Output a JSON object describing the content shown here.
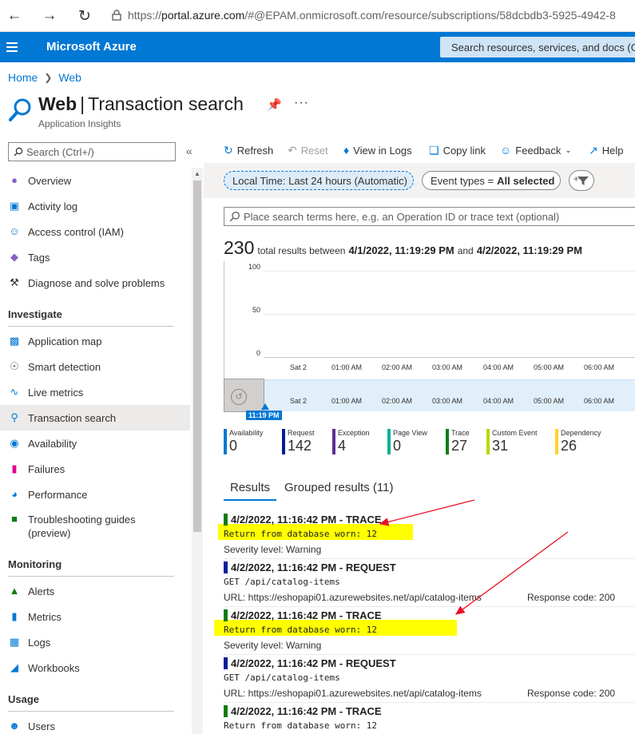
{
  "browser": {
    "url_prefix": "https://",
    "url_host": "portal.azure.com",
    "url_rest": "/#@EPAM.onmicrosoft.com/resource/subscriptions/58dcbdb3-5925-4942-8"
  },
  "header": {
    "brand": "Microsoft Azure",
    "search_placeholder": "Search resources, services, and docs (G+/)"
  },
  "breadcrumb": {
    "home": "Home",
    "current": "Web"
  },
  "title": {
    "resource": "Web",
    "separator": "|",
    "page": "Transaction search",
    "subtitle": "Application Insights"
  },
  "sidebar": {
    "search_placeholder": "Search (Ctrl+/)",
    "items_top": [
      {
        "label": "Overview",
        "icon": "bulb-icon"
      },
      {
        "label": "Activity log",
        "icon": "activity-log-icon"
      },
      {
        "label": "Access control (IAM)",
        "icon": "people-icon"
      },
      {
        "label": "Tags",
        "icon": "tag-icon"
      },
      {
        "label": "Diagnose and solve problems",
        "icon": "wrench-icon"
      }
    ],
    "sections": {
      "investigate": "Investigate",
      "monitoring": "Monitoring",
      "usage": "Usage"
    },
    "investigate_items": [
      {
        "label": "Application map",
        "icon": "app-map-icon"
      },
      {
        "label": "Smart detection",
        "icon": "smart-detection-icon"
      },
      {
        "label": "Live metrics",
        "icon": "live-metrics-icon"
      },
      {
        "label": "Transaction search",
        "icon": "search-icon"
      },
      {
        "label": "Availability",
        "icon": "globe-icon"
      },
      {
        "label": "Failures",
        "icon": "failures-icon"
      },
      {
        "label": "Performance",
        "icon": "performance-icon"
      },
      {
        "label": "Troubleshooting guides",
        "label2": "(preview)",
        "icon": "guide-icon"
      }
    ],
    "monitoring_items": [
      {
        "label": "Alerts",
        "icon": "alerts-icon"
      },
      {
        "label": "Metrics",
        "icon": "metrics-icon"
      },
      {
        "label": "Logs",
        "icon": "logs-icon"
      },
      {
        "label": "Workbooks",
        "icon": "workbooks-icon"
      }
    ],
    "usage_items": [
      {
        "label": "Users",
        "icon": "users-icon"
      }
    ]
  },
  "toolbar": {
    "refresh": "Refresh",
    "reset": "Reset",
    "view_in_logs": "View in Logs",
    "copy_link": "Copy link",
    "feedback": "Feedback",
    "help": "Help"
  },
  "filters": {
    "time": "Local Time: Last 24 hours (Automatic)",
    "event_types_label": "Event types =",
    "event_types_value": "All selected",
    "search_placeholder": "Place search terms here, e.g. an Operation ID or trace text (optional)"
  },
  "summary": {
    "count": "230",
    "text1": "total results between",
    "from": "4/1/2022, 11:19:29 PM",
    "and": "and",
    "to": "4/2/2022, 11:19:29 PM"
  },
  "chart_data": {
    "type": "bar",
    "y_ticks": [
      "100",
      "50",
      "0"
    ],
    "x_ticks": [
      "Sat 2",
      "01:00 AM",
      "02:00 AM",
      "03:00 AM",
      "04:00 AM",
      "05:00 AM",
      "06:00 AM"
    ],
    "selection_label": "11:19 PM",
    "ylim": [
      0,
      100
    ]
  },
  "event_counts": [
    {
      "name": "Availability",
      "value": "0",
      "color": "#0078d4"
    },
    {
      "name": "Request",
      "value": "142",
      "color": "#001d9b"
    },
    {
      "name": "Exception",
      "value": "4",
      "color": "#5c2d91"
    },
    {
      "name": "Page View",
      "value": "0",
      "color": "#00b294"
    },
    {
      "name": "Trace",
      "value": "27",
      "color": "#107c10"
    },
    {
      "name": "Custom Event",
      "value": "31",
      "color": "#bad80a"
    },
    {
      "name": "Dependency",
      "value": "26",
      "color": "#ffd12c"
    }
  ],
  "tabs": {
    "results": "Results",
    "grouped": "Grouped results (11)"
  },
  "results": [
    {
      "header": "4/2/2022, 11:16:42 PM - TRACE",
      "color": "#107c10",
      "body": "Return from database worn: 12",
      "line": "Severity level: Warning"
    },
    {
      "header": "4/2/2022, 11:16:42 PM - REQUEST",
      "color": "#001d9b",
      "body": "GET /api/catalog-items",
      "line": "URL: https://eshopapi01.azurewebsites.net/api/catalog-items",
      "code": "Response code: 200"
    },
    {
      "header": "4/2/2022, 11:16:42 PM - TRACE",
      "color": "#107c10",
      "body": "Return from database worn: 12",
      "line": "Severity level: Warning"
    },
    {
      "header": "4/2/2022, 11:16:42 PM - REQUEST",
      "color": "#001d9b",
      "body": "GET /api/catalog-items",
      "line": "URL: https://eshopapi01.azurewebsites.net/api/catalog-items",
      "code": "Response code: 200"
    },
    {
      "header": "4/2/2022, 11:16:42 PM - TRACE",
      "color": "#107c10",
      "body": "Return from database worn: 12"
    }
  ],
  "colors": {
    "accent": "#0078d4",
    "highlight": "#ffff00",
    "annotation_arrow": "#e81123"
  }
}
